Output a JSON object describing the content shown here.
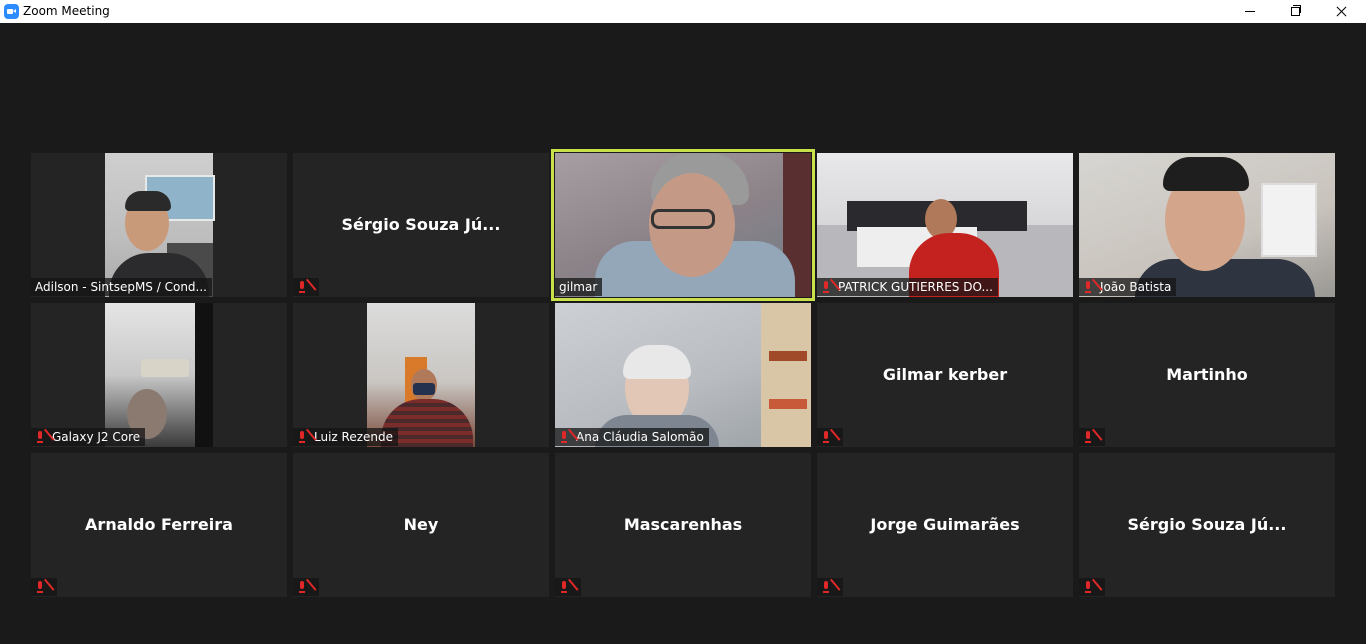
{
  "window": {
    "title": "Zoom Meeting"
  },
  "icons": {
    "app": "zoom-camera-icon",
    "minimize": "minimize-icon",
    "restore": "restore-icon",
    "close": "close-icon",
    "muted_mic": "muted-mic-icon"
  },
  "colors": {
    "background": "#1a1a1a",
    "tile": "#242424",
    "active_speaker_border": "#c9e04a",
    "muted_icon": "#e02828",
    "zoom_blue": "#2D8CFF"
  },
  "participants": [
    {
      "name": "Adilson - SintsepMS / Cond...",
      "video": true,
      "muted": false,
      "speaking": false
    },
    {
      "name": "Sérgio Souza Jú...",
      "video": false,
      "muted": true,
      "speaking": false
    },
    {
      "name": "gilmar",
      "video": true,
      "muted": false,
      "speaking": true
    },
    {
      "name": "PATRICK GUTIERRES DO...",
      "video": true,
      "muted": true,
      "speaking": false
    },
    {
      "name": "João Batista",
      "video": true,
      "muted": true,
      "speaking": false
    },
    {
      "name": "Galaxy J2 Core",
      "video": true,
      "muted": true,
      "speaking": false
    },
    {
      "name": "Luiz Rezende",
      "video": true,
      "muted": true,
      "speaking": false
    },
    {
      "name": "Ana Cláudia Salomão",
      "video": true,
      "muted": true,
      "speaking": false
    },
    {
      "name": "Gilmar kerber",
      "video": false,
      "muted": true,
      "speaking": false
    },
    {
      "name": "Martinho",
      "video": false,
      "muted": true,
      "speaking": false
    },
    {
      "name": "Arnaldo Ferreira",
      "video": false,
      "muted": true,
      "speaking": false
    },
    {
      "name": "Ney",
      "video": false,
      "muted": true,
      "speaking": false
    },
    {
      "name": "Mascarenhas",
      "video": false,
      "muted": true,
      "speaking": false
    },
    {
      "name": "Jorge Guimarães",
      "video": false,
      "muted": true,
      "speaking": false
    },
    {
      "name": "Sérgio Souza Jú...",
      "video": false,
      "muted": true,
      "speaking": false
    }
  ]
}
